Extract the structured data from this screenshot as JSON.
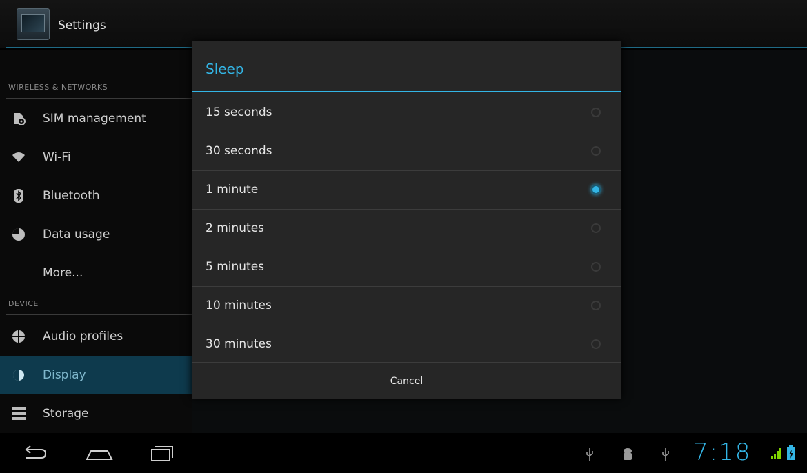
{
  "header": {
    "title": "Settings",
    "app_icon": "settings-app-icon"
  },
  "sidebar": {
    "sections": [
      {
        "header": "WIRELESS & NETWORKS",
        "items": [
          {
            "label": "SIM management",
            "icon": "sim-management-icon"
          },
          {
            "label": "Wi-Fi",
            "icon": "wifi-icon"
          },
          {
            "label": "Bluetooth",
            "icon": "bluetooth-icon"
          },
          {
            "label": "Data usage",
            "icon": "data-usage-icon"
          },
          {
            "label": "More...",
            "icon": ""
          }
        ]
      },
      {
        "header": "DEVICE",
        "items": [
          {
            "label": "Audio profiles",
            "icon": "audio-profiles-icon"
          },
          {
            "label": "Display",
            "icon": "display-icon",
            "selected": true
          },
          {
            "label": "Storage",
            "icon": "storage-icon"
          }
        ]
      }
    ]
  },
  "dialog": {
    "title": "Sleep",
    "options": [
      {
        "label": "15 seconds",
        "checked": false
      },
      {
        "label": "30 seconds",
        "checked": false
      },
      {
        "label": "1 minute",
        "checked": true
      },
      {
        "label": "2 minutes",
        "checked": false
      },
      {
        "label": "5 minutes",
        "checked": false
      },
      {
        "label": "10 minutes",
        "checked": false
      },
      {
        "label": "30 minutes",
        "checked": false
      }
    ],
    "cancel_label": "Cancel"
  },
  "systembar": {
    "nav": [
      "back-icon",
      "home-icon",
      "recent-apps-icon"
    ],
    "status_icons": [
      "usb-icon",
      "android-debug-icon",
      "usb-icon",
      "signal-icon",
      "battery-icon"
    ],
    "time": "7:18"
  },
  "colors": {
    "accent": "#33b5e5",
    "selected_bg": "#0e3a4d"
  }
}
